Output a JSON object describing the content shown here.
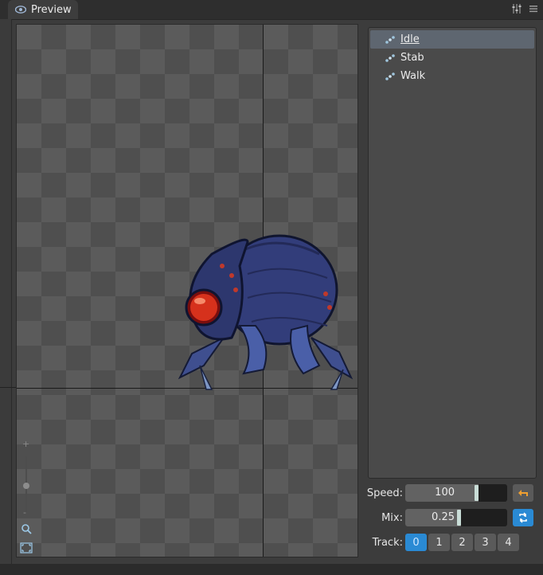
{
  "panel": {
    "title": "Preview",
    "icon": "eye-icon"
  },
  "toolbar_icons": [
    "settings-sliders-icon",
    "menu-icon"
  ],
  "animations": [
    {
      "label": "Idle",
      "selected": true
    },
    {
      "label": "Stab",
      "selected": false
    },
    {
      "label": "Walk",
      "selected": false
    }
  ],
  "controls": {
    "speed_label": "Speed:",
    "speed_value": "100",
    "speed_fraction": 0.72,
    "mix_label": "Mix:",
    "mix_value": "0.25",
    "mix_fraction": 0.55,
    "track_label": "Track:",
    "tracks": [
      "0",
      "1",
      "2",
      "3",
      "4"
    ],
    "active_track": "0"
  },
  "zoom": {
    "plus": "+",
    "minus": "-"
  },
  "colors": {
    "accent": "#2a8ad4",
    "back_arrow": "#f0a030",
    "selection": "#5e6670"
  }
}
